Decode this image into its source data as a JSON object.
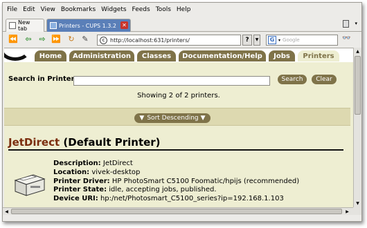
{
  "menubar": {
    "items": [
      "File",
      "Edit",
      "View",
      "Bookmarks",
      "Widgets",
      "Feeds",
      "Tools",
      "Help"
    ]
  },
  "tabs": {
    "new_tab": "New tab",
    "active_tab": "Printers - CUPS 1.3.2"
  },
  "toolbar": {
    "url": "http://localhost:631/printers/",
    "search_placeholder": "Google",
    "help_label": "?"
  },
  "cups_nav": {
    "tabs": [
      "Home",
      "Administration",
      "Classes",
      "Documentation/Help",
      "Jobs",
      "Printers"
    ],
    "active": "Printers"
  },
  "search": {
    "label": "Search in Printers:",
    "value": "",
    "search_button": "Search",
    "clear_button": "Clear"
  },
  "results": {
    "showing": "Showing 2 of 2 printers."
  },
  "sort": {
    "label": "Sort Descending"
  },
  "printer": {
    "name": "JetDirect",
    "suffix": "(Default Printer)",
    "details": [
      {
        "label": "Description:",
        "value": "JetDirect"
      },
      {
        "label": "Location:",
        "value": "vivek-desktop"
      },
      {
        "label": "Printer Driver:",
        "value": "HP PhotoSmart C5100 Foomatic/hpijs (recommended)"
      },
      {
        "label": "Printer State:",
        "value": "idle, accepting jobs, published."
      },
      {
        "label": "Device URI:",
        "value": "hp:/net/Photosmart_C5100_series?ip=192.168.1.103"
      }
    ]
  },
  "colors": {
    "cups_tab": "#7f7349",
    "cups_bg": "#eeeed2",
    "printer_link": "#7b2d0e",
    "active_browser_tab": "#5a7fb8"
  }
}
